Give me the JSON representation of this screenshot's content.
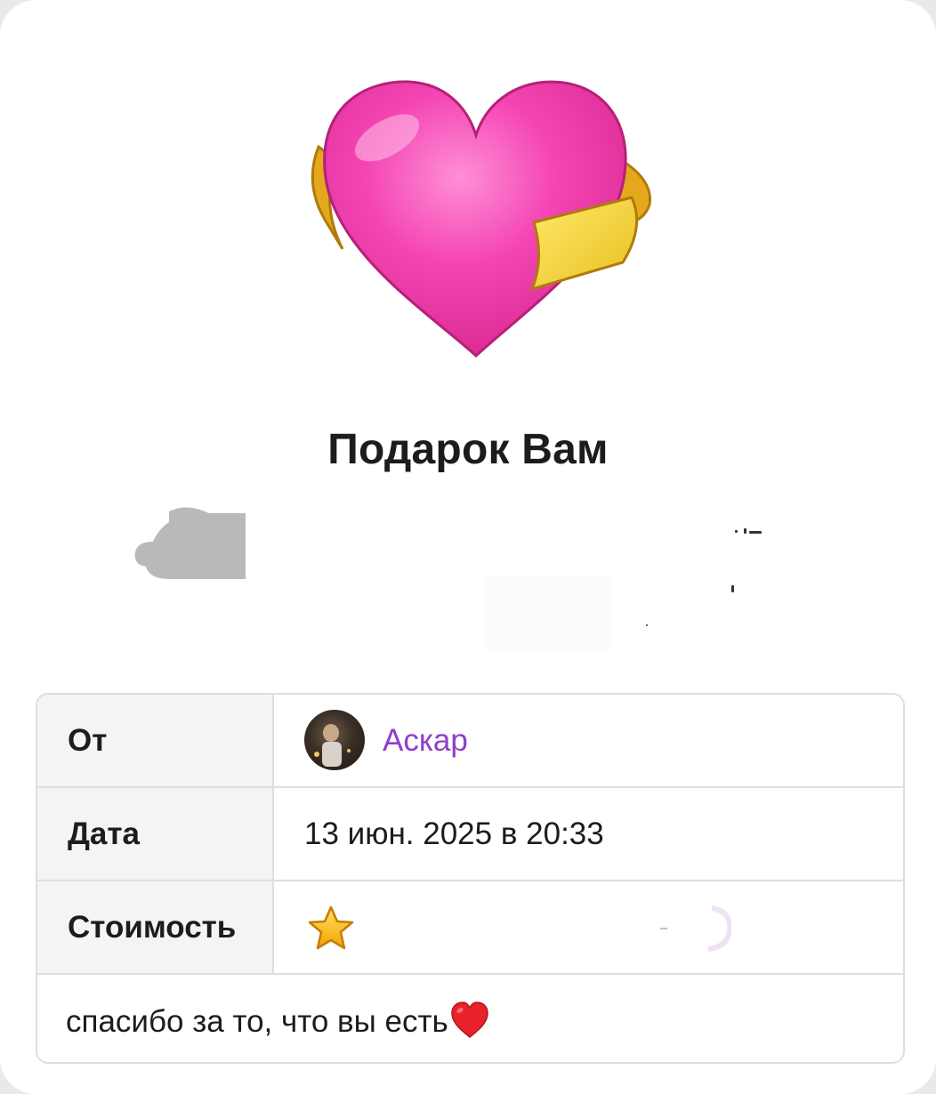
{
  "gift": {
    "icon": "heart-with-ribbon-icon",
    "title": "Подарок Вам"
  },
  "details": {
    "from_label": "От",
    "from_name": "Аскар",
    "date_label": "Дата",
    "date_value": "13 июн. 2025 в 20:33",
    "cost_label": "Стоимость",
    "cost_icon": "star-icon"
  },
  "comment": {
    "text": "спасибо за то, что вы есть",
    "emoji": "red-heart-icon"
  },
  "colors": {
    "link": "#8e3fc8",
    "heart_pink": "#f23fa8",
    "ribbon_gold": "#e2b41c"
  }
}
